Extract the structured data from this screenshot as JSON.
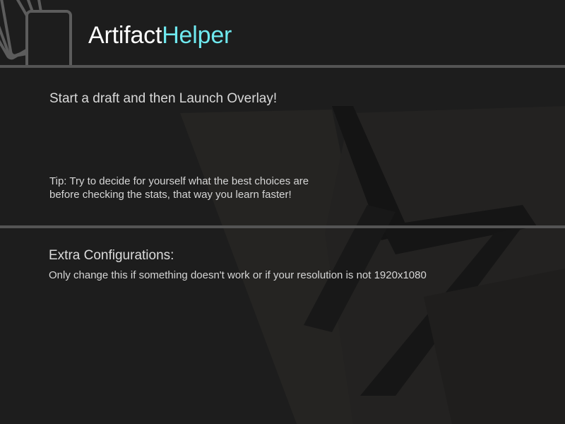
{
  "app": {
    "brand_part1": "Artifact",
    "brand_part2": "Helper",
    "logo_icon": "cards-icon",
    "accent_color": "#6fe9ef"
  },
  "main": {
    "instruction": "Start a draft and then Launch Overlay!",
    "tip_line1": "Tip: Try to decide for yourself what the best choices are",
    "tip_line2": "before checking the stats, that way you learn faster!"
  },
  "extra": {
    "title": "Extra Configurations:",
    "description": "Only change this if something doesn't work or if your resolution is not 1920x1080"
  }
}
